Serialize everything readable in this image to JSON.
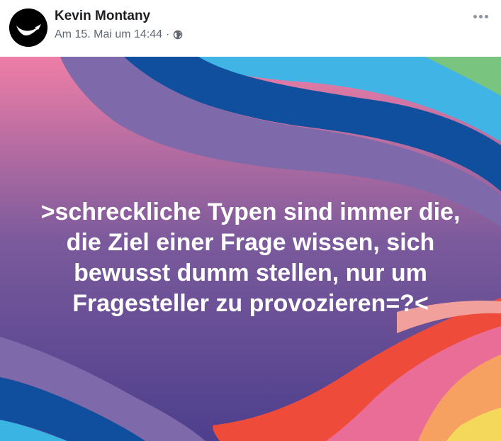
{
  "author": {
    "name": "Kevin Montany",
    "avatar_icon": "bird-logo-icon"
  },
  "meta": {
    "timestamp": "Am 15. Mai um 14:44",
    "separator": "·",
    "privacy_icon": "globe-icon"
  },
  "menu": {
    "icon": "more-options-icon"
  },
  "post": {
    "text": ">schreckliche Typen sind immer die,\ndie Ziel einer Frage wissen, sich\nbewusst dumm stellen, nur um\nFragesteller zu provozieren=?<",
    "text_color": "#ffffff",
    "background": {
      "gradient_top": "#ee7ea6",
      "gradient_mid": "#7b5a9c",
      "gradient_bottom": "#4d3f8d",
      "stripe_colors": [
        "#7e69aa",
        "#0f4f9d",
        "#41b4e6",
        "#79c47f",
        "#f2a09b",
        "#ee4b3b",
        "#ea6d98",
        "#f6a061",
        "#f3d85b",
        "#39b4e3"
      ]
    }
  }
}
